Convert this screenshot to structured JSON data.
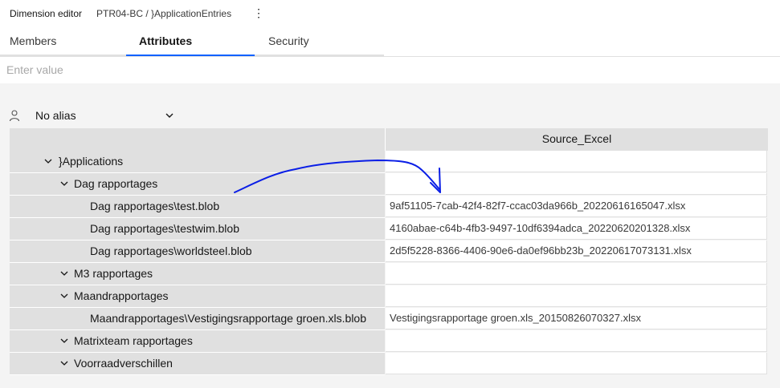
{
  "header": {
    "title": "Dimension editor",
    "path": "PTR04-BC / }ApplicationEntries",
    "more_icon": "overflow-menu-vertical-icon"
  },
  "tabs": [
    {
      "label": "Members",
      "active": false
    },
    {
      "label": "Attributes",
      "active": true
    },
    {
      "label": "Security",
      "active": false
    }
  ],
  "value_input": {
    "placeholder": "Enter value",
    "value": ""
  },
  "alias": {
    "icon": "user-icon",
    "selected": "No alias"
  },
  "grid": {
    "column_header": "Source_Excel",
    "rows": [
      {
        "label": "}Applications",
        "level": 0,
        "expandable": true,
        "value": ""
      },
      {
        "label": "Dag rapportages",
        "level": 1,
        "expandable": true,
        "value": ""
      },
      {
        "label": "Dag rapportages\\test.blob",
        "level": 2,
        "expandable": false,
        "value": "9af51105-7cab-42f4-82f7-ccac03da966b_20220616165047.xlsx"
      },
      {
        "label": "Dag rapportages\\testwim.blob",
        "level": 2,
        "expandable": false,
        "value": "4160abae-c64b-4fb3-9497-10df6394adca_20220620201328.xlsx"
      },
      {
        "label": "Dag rapportages\\worldsteel.blob",
        "level": 2,
        "expandable": false,
        "value": "2d5f5228-8366-4406-90e6-da0ef96bb23b_20220617073131.xlsx"
      },
      {
        "label": "M3 rapportages",
        "level": 1,
        "expandable": true,
        "value": ""
      },
      {
        "label": "Maandrapportages",
        "level": 1,
        "expandable": true,
        "value": ""
      },
      {
        "label": "Maandrapportages\\Vestigingsrapportage groen.xls.blob",
        "level": 2,
        "expandable": false,
        "value": "Vestigingsrapportage groen.xls_20150826070327.xlsx"
      },
      {
        "label": "Matrixteam rapportages",
        "level": 1,
        "expandable": true,
        "value": ""
      },
      {
        "label": "Voorraadverschillen",
        "level": 1,
        "expandable": true,
        "value": ""
      }
    ]
  },
  "annotation": {
    "color": "#0a1ee6"
  }
}
